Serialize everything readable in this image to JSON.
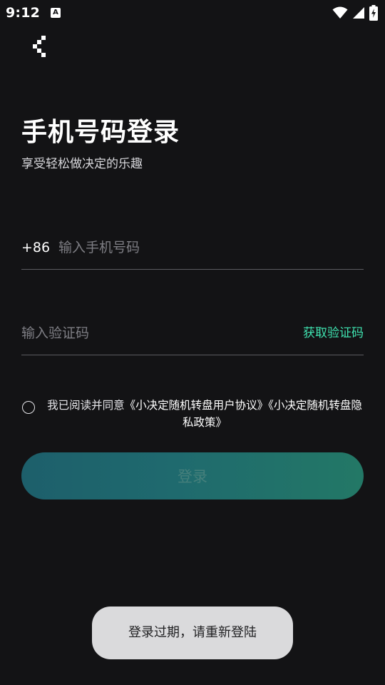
{
  "status_bar": {
    "time": "9:12",
    "app_icon_letter": "A",
    "icons": [
      "wifi-icon",
      "cell-signal-icon",
      "battery-charging-icon"
    ]
  },
  "nav": {
    "back_icon": "back-chevron-icon"
  },
  "header": {
    "title": "手机号码登录",
    "subtitle": "享受轻松做决定的乐趣"
  },
  "phone": {
    "country_code": "+86",
    "placeholder": "输入手机号码",
    "value": ""
  },
  "code": {
    "placeholder": "输入验证码",
    "value": "",
    "get_code_label": "获取验证码"
  },
  "agreement": {
    "checked": false,
    "prefix": "我已阅读并同意",
    "user_agreement": "《小决定随机转盘用户协议》",
    "privacy_policy": "《小决定随机转盘隐私政策》"
  },
  "login": {
    "label": "登录"
  },
  "toast": {
    "message": "登录过期，请重新登陆"
  },
  "colors": {
    "background": "#131315",
    "accent": "#3fe3b0",
    "button_gradient_start": "#1d5f6b",
    "button_gradient_end": "#237866",
    "toast_background": "#dadadc"
  }
}
